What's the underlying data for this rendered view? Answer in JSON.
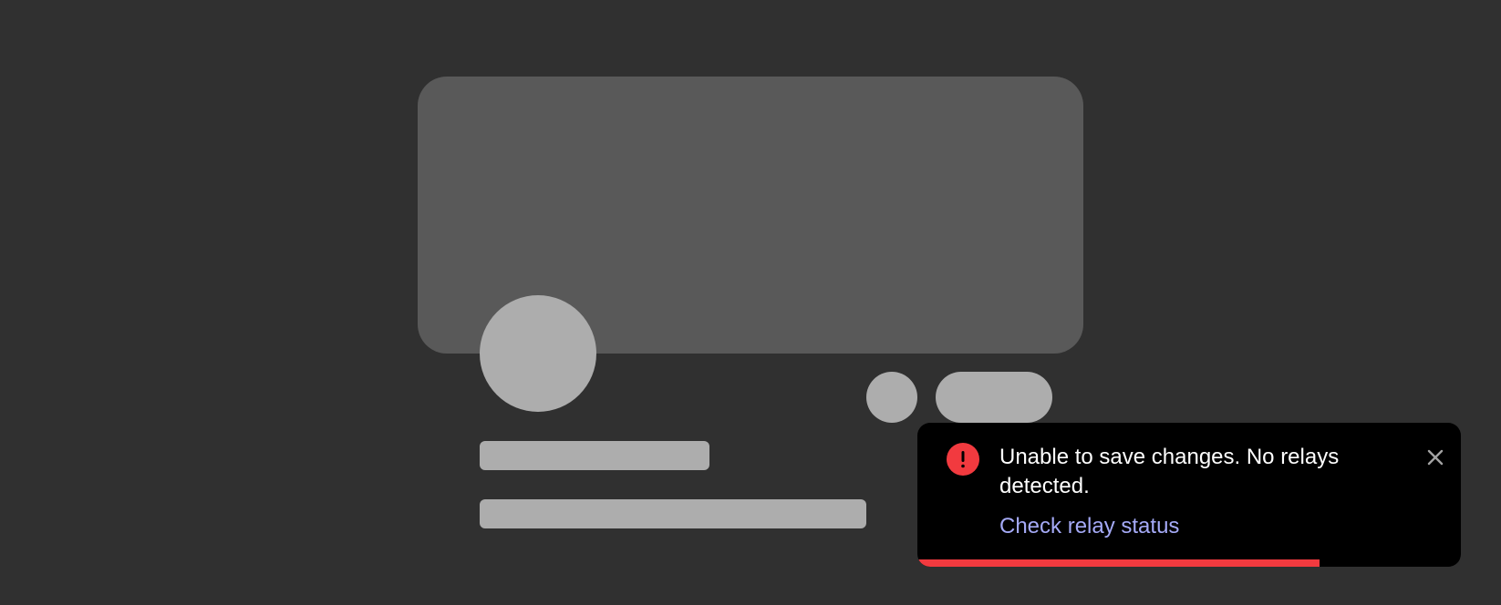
{
  "toast": {
    "icon": "error-exclamation-icon",
    "message": "Unable to save changes. No relays detected.",
    "action_label": "Check relay status",
    "close_icon": "close-icon",
    "progress_fraction": 0.74,
    "colors": {
      "background": "#000000",
      "error": "#f23a3f",
      "link": "#a5aaf7",
      "text": "#ffffff"
    }
  },
  "skeleton": {
    "colors": {
      "page_background": "#303030",
      "banner": "#595959",
      "placeholder": "#adadad"
    }
  }
}
